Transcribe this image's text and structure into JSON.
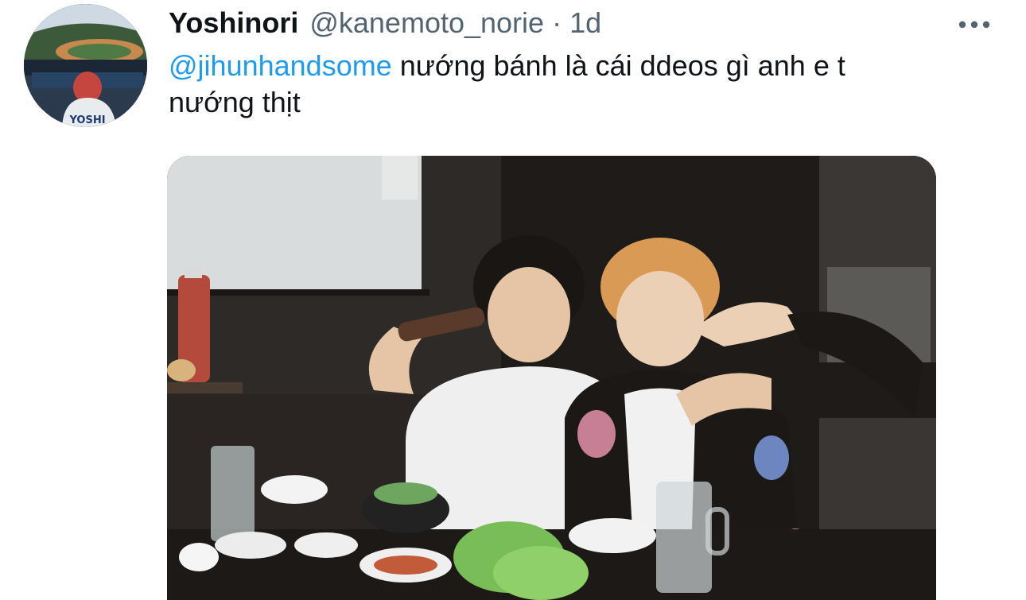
{
  "tweet": {
    "author": {
      "display_name": "Yoshinori",
      "handle": "@kanemoto_norie",
      "avatar_jersey_text": "YOSHI"
    },
    "separator": "·",
    "timestamp": "1d",
    "text": {
      "mention": "@jihunhandsome",
      "body_line1": " nướng bánh là cái ddeos gì anh e t",
      "body_line2": "nướng thịt"
    },
    "more_icon": "more-horizontal-icon",
    "media": {
      "kind": "photo",
      "description_icon": "photo"
    }
  },
  "colors": {
    "text_primary": "#0f1419",
    "text_secondary": "#536471",
    "link": "#1d9bf0",
    "background": "#ffffff"
  }
}
